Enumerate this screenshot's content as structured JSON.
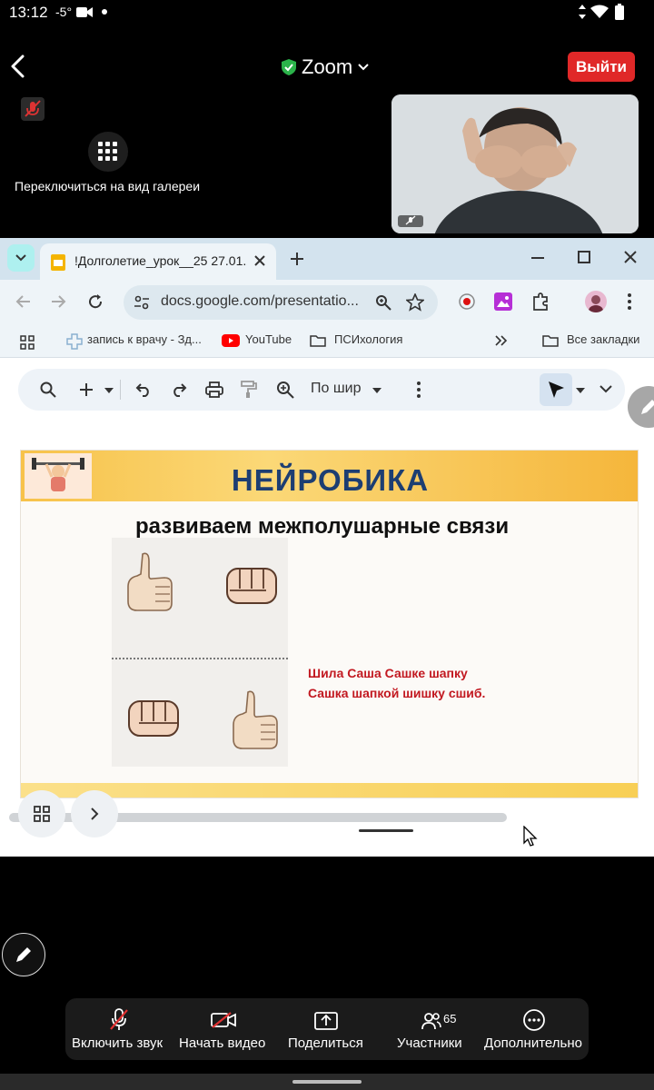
{
  "status_bar": {
    "time": "13:12",
    "temp": "-5°"
  },
  "header": {
    "title": "Zoom",
    "exit_label": "Выйти"
  },
  "gallery": {
    "label": "Переключиться на вид галереи"
  },
  "browser": {
    "tab_title": "!Долголетие_урок__25 27.01.25",
    "url": "docs.google.com/presentatio...",
    "bookmarks": [
      "запись к врачу - Зд...",
      "YouTube",
      "ПСИхология",
      "Все закладки"
    ]
  },
  "slides_toolbar": {
    "zoom_label": "По шир"
  },
  "slide": {
    "title": "НЕЙРОБИКА",
    "subtitle": "развиваем межполушарные связи",
    "rhyme_line1": "Шила Саша Сашке шапку",
    "rhyme_line2": "Сашка шапкой шишку сшиб."
  },
  "toolbar": {
    "audio": "Включить звук",
    "video": "Начать видео",
    "share": "Поделиться",
    "participants": "Участники",
    "participants_count": "65",
    "more": "Дополнительно"
  },
  "colors": {
    "exit": "#e02828",
    "slide_title": "#1d3e72",
    "rhyme": "#c21820",
    "shield": "#2bb34a"
  }
}
